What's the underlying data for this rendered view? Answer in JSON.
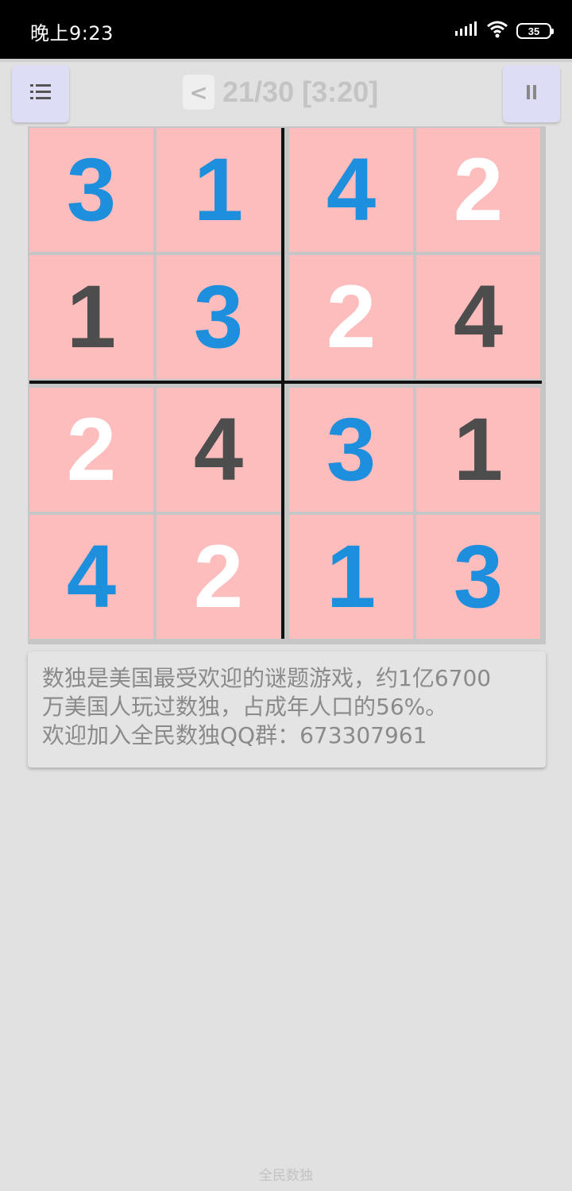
{
  "status_bar": {
    "time": "晚上9:23",
    "battery": "35",
    "icons": [
      "signal-icon",
      "wifi-icon",
      "battery-icon"
    ]
  },
  "toolbar": {
    "menu_icon": "list-icon",
    "back_label": "<",
    "title": "21/30 [3:20]",
    "pause_icon": "pause-icon"
  },
  "board": {
    "size": 4,
    "colors": {
      "cell_bg": "#fdbdbd",
      "blue": "#1e8fdd",
      "dark": "#4d4d4d",
      "white": "#ffffff"
    },
    "cells": [
      [
        {
          "value": "3",
          "style": "blue"
        },
        {
          "value": "1",
          "style": "blue"
        },
        {
          "value": "4",
          "style": "blue"
        },
        {
          "value": "2",
          "style": "white"
        }
      ],
      [
        {
          "value": "1",
          "style": "dark"
        },
        {
          "value": "3",
          "style": "blue"
        },
        {
          "value": "2",
          "style": "white"
        },
        {
          "value": "4",
          "style": "dark"
        }
      ],
      [
        {
          "value": "2",
          "style": "white"
        },
        {
          "value": "4",
          "style": "dark"
        },
        {
          "value": "3",
          "style": "blue"
        },
        {
          "value": "1",
          "style": "dark"
        }
      ],
      [
        {
          "value": "4",
          "style": "blue"
        },
        {
          "value": "2",
          "style": "white"
        },
        {
          "value": "1",
          "style": "blue"
        },
        {
          "value": "3",
          "style": "blue"
        }
      ]
    ]
  },
  "info": {
    "lines": [
      "数独是美国最受欢迎的谜题游戏，约1亿6700",
      "万美国人玩过数独，占成年人口的56%。",
      "欢迎加入全民数独QQ群：673307961"
    ]
  },
  "footer": {
    "app_name": "全民数独"
  }
}
